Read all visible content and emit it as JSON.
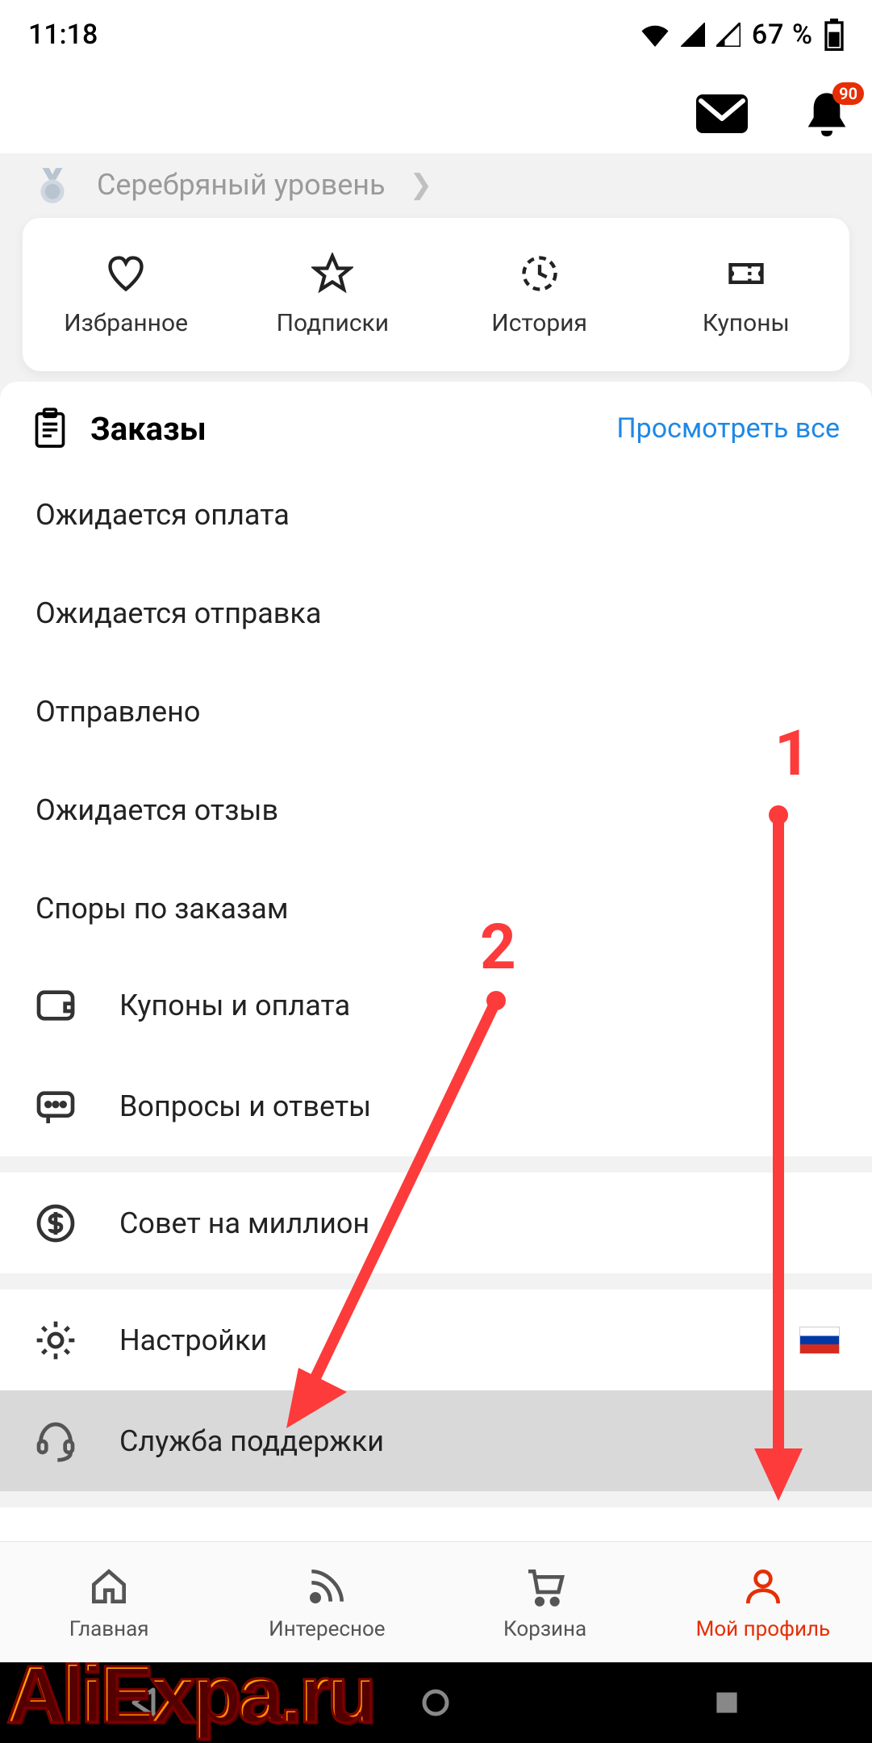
{
  "status": {
    "time": "11:18",
    "battery_text": "67 %"
  },
  "header": {
    "notification_count": "90"
  },
  "level": {
    "label": "Серебряный уровень"
  },
  "quick": {
    "favorites": "Избранное",
    "subscriptions": "Подписки",
    "history": "История",
    "coupons": "Купоны"
  },
  "orders": {
    "title": "Заказы",
    "view_all": "Просмотреть все",
    "statuses": {
      "awaiting_payment": "Ожидается оплата",
      "awaiting_shipping": "Ожидается отправка",
      "shipped": "Отправлено",
      "awaiting_review": "Ожидается отзыв",
      "disputes": "Споры по заказам"
    }
  },
  "menu": {
    "coupons_payment": "Купоны и оплата",
    "qa": "Вопросы и ответы",
    "tip": "Совет на миллион",
    "settings": "Настройки",
    "support": "Служба поддержки"
  },
  "tabs": {
    "home": "Главная",
    "feed": "Интересное",
    "cart": "Корзина",
    "profile": "Мой профиль"
  },
  "annotations": {
    "one": "1",
    "two": "2"
  },
  "watermark": {
    "text": "AliExpa.ru"
  }
}
